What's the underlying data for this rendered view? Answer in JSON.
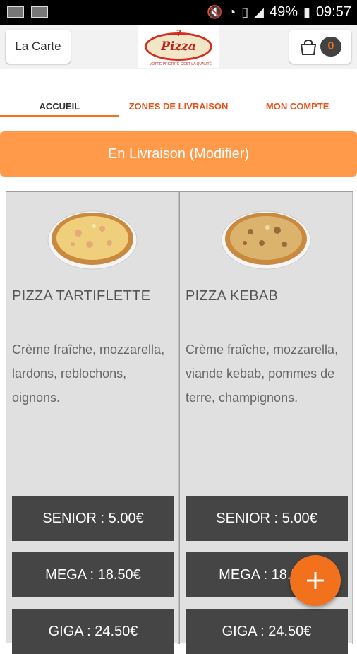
{
  "status_bar": {
    "battery": "49%",
    "time": "09:57"
  },
  "header": {
    "menu_button": "La Carte",
    "logo": {
      "name": "Pizza",
      "number": "7",
      "tagline": "VOTRE PRIORITÉ C'EST LA QUALITÉ"
    },
    "cart_count": "0"
  },
  "tabs": [
    {
      "label": "ACCUEIL",
      "active": true
    },
    {
      "label": "ZONES DE LIVRAISON",
      "active": false
    },
    {
      "label": "MON COMPTE",
      "active": false
    }
  ],
  "delivery_button": "En Livraison (Modifier)",
  "products": [
    {
      "name": "PIZZA TARTIFLETTE",
      "description": "Crème fraîche, mozzarella, lardons, reblochons, oignons.",
      "prices": [
        "SENIOR : 5.00€",
        "MEGA : 18.50€",
        "GIGA : 24.50€"
      ]
    },
    {
      "name": "PIZZA KEBAB",
      "description": "Crème fraîche, mozzarella, viande kebab, pommes de terre, champignons.",
      "prices": [
        "SENIOR : 5.00€",
        "MEGA : 18.50€",
        "GIGA : 24.50€"
      ]
    }
  ],
  "colors": {
    "accent": "#f2711c",
    "delivery_bg": "#ff9a4a",
    "price_bg": "#454545"
  }
}
